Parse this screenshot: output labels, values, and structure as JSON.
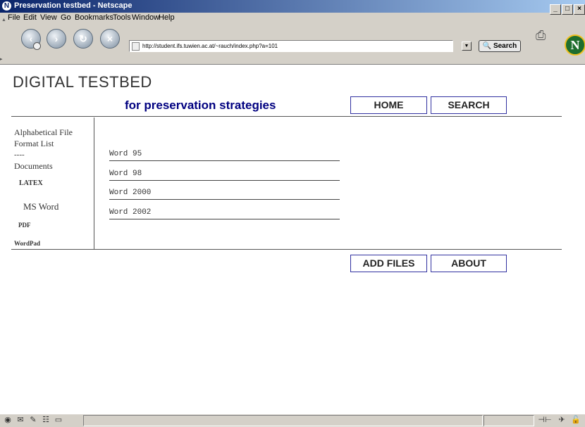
{
  "window": {
    "title": "Preservation testbed - Netscape"
  },
  "menu": [
    {
      "label": "File"
    },
    {
      "label": "Edit"
    },
    {
      "label": "View"
    },
    {
      "label": "Go"
    },
    {
      "label": "Bookmarks"
    },
    {
      "label": "Tools"
    },
    {
      "label": "Window"
    },
    {
      "label": "Help"
    }
  ],
  "toolbar": {
    "back_icon": "back-arrow-icon",
    "forward_icon": "forward-arrow-icon",
    "reload_icon": "reload-icon",
    "stop_icon": "stop-icon",
    "url": "http://student.ifs.tuwien.ac.at/~rauch/index.php?a=101",
    "search_label": "Search"
  },
  "page": {
    "heading": "DIGITAL TESTBED",
    "subheading": "for preservation strategies",
    "nav_buttons": {
      "home": "HOME",
      "search": "SEARCH"
    },
    "bottom_buttons": {
      "add_files": "ADD FILES",
      "about": "ABOUT"
    },
    "sidebar": {
      "alpha_list": "Alphabetical File Format List",
      "separator": "----",
      "documents": "Documents",
      "items": [
        "LATEX",
        "MS Word",
        "PDF",
        "WordPad"
      ]
    },
    "files": [
      "Word 95",
      "Word 98",
      "Word 2000",
      "Word 2002"
    ]
  },
  "colors": {
    "accent": "#000080",
    "titlebar": "#0a246a",
    "chrome": "#d4d0c8"
  }
}
